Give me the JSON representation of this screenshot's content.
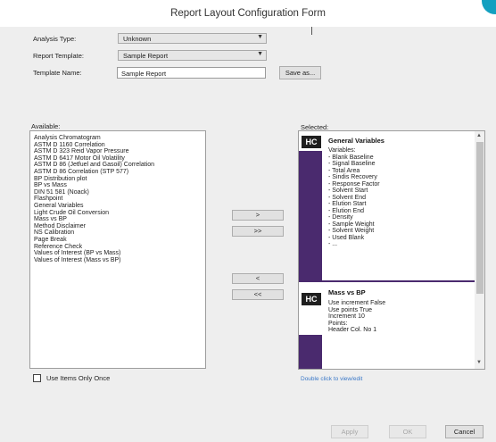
{
  "window": {
    "title": "Report Layout Configuration Form"
  },
  "form": {
    "analysis_type_label": "Analysis Type:",
    "analysis_type_value": "Unknown",
    "report_template_label": "Report Template:",
    "report_template_value": "Sample Report",
    "template_name_label": "Template Name:",
    "template_name_value": "Sample Report",
    "save_as_label": "Save as..."
  },
  "available": {
    "label": "Available:",
    "items": [
      "Analysis Chromatogram",
      "ASTM D 1160 Correlation",
      "ASTM D 323 Reid Vapor Pressure",
      "ASTM D 6417 Motor Oil Volatility",
      "ASTM D 86 (Jetfuel and Gasoil) Correlation",
      "ASTM D 86 Correlation (STP 577)",
      "BP Distribution plot",
      "BP vs Mass",
      "DIN 51 581 (Noack)",
      "Flashpoint",
      "General Variables",
      "Light Crude Oil Conversion",
      "Mass vs BP",
      "Method Disclaimer",
      "NS Calibration",
      "Page Break",
      "Reference Check",
      "Values of Interest (BP vs Mass)",
      "Values of Interest (Mass vs BP)"
    ]
  },
  "transfer": {
    "add_one": ">",
    "add_all": ">>",
    "remove_one": "<",
    "remove_all": "<<"
  },
  "selected": {
    "label": "Selected:",
    "cards": [
      {
        "badge": "HC",
        "title": "General Variables",
        "lines": [
          "Variables:",
          "- Blank Baseline",
          "- Signal Baseline",
          "- Total Area",
          "- Sindis Recovery",
          "- Response Factor",
          "- Solvent Start",
          "- Solvent End",
          "- Elution Start",
          "- Elution End",
          "- Density",
          "- Sample Weight",
          "- Solvent Weight",
          "- Used Blank",
          "- ..."
        ]
      },
      {
        "badge": "HC",
        "title": "Mass vs BP",
        "lines": [
          "Use increment False",
          "Use points True",
          "Increment 10",
          "Points:",
          "Header Col. No 1"
        ]
      }
    ],
    "hint": "Double click to view/edit"
  },
  "options": {
    "use_items_once_label": "Use Items Only Once"
  },
  "footer": {
    "apply": "Apply",
    "ok": "OK",
    "cancel": "Cancel"
  },
  "colors": {
    "accent": "#13a0c0",
    "band": "#4a2a6e",
    "link": "#3a78c8"
  }
}
